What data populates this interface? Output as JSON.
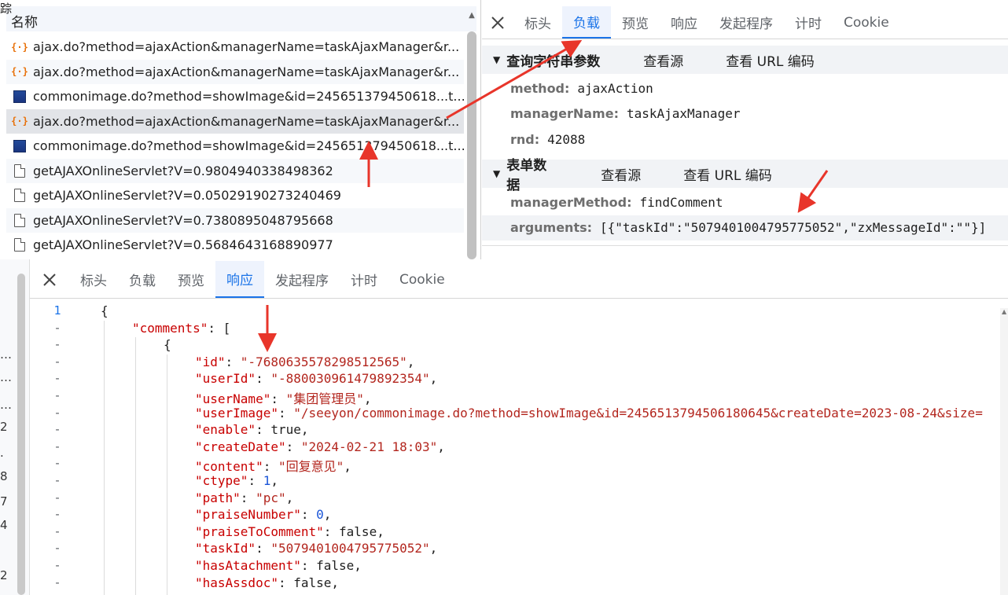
{
  "network": {
    "header": "名称",
    "rows": [
      {
        "icon": "xhr-icon",
        "name": "ajax.do?method=ajaxAction&managerName=taskAjaxManager&r..."
      },
      {
        "icon": "xhr-icon",
        "name": "ajax.do?method=ajaxAction&managerName=taskAjaxManager&r..."
      },
      {
        "icon": "image-icon",
        "name": "commonimage.do?method=showImage&id=245651379450618...t..."
      },
      {
        "icon": "xhr-icon",
        "name": "ajax.do?method=ajaxAction&managerName=taskAjaxManager&r..."
      },
      {
        "icon": "image-icon",
        "name": "commonimage.do?method=showImage&id=245651379450618...t..."
      },
      {
        "icon": "document-icon",
        "name": "getAJAXOnlineServlet?V=0.9804940338498362"
      },
      {
        "icon": "document-icon",
        "name": "getAJAXOnlineServlet?V=0.05029190273240469"
      },
      {
        "icon": "document-icon",
        "name": "getAJAXOnlineServlet?V=0.7380895048795668"
      },
      {
        "icon": "document-icon",
        "name": "getAJAXOnlineServlet?V=0.5684643168890977"
      }
    ],
    "selected_index": 3
  },
  "top_tabs": [
    "标头",
    "负载",
    "预览",
    "响应",
    "发起程序",
    "计时",
    "Cookie"
  ],
  "top_active": "负载",
  "payload": {
    "query": {
      "title": "查询字符串参数",
      "view_source": "查看源",
      "view_url": "查看 URL 编码",
      "params": [
        {
          "key": "method:",
          "value": "ajaxAction"
        },
        {
          "key": "managerName:",
          "value": "taskAjaxManager"
        },
        {
          "key": "rnd:",
          "value": "42088"
        }
      ]
    },
    "form": {
      "title": "表单数据",
      "view_source": "查看源",
      "view_url": "查看 URL 编码",
      "params": [
        {
          "key": "managerMethod:",
          "value": "findComment"
        },
        {
          "key": "arguments:",
          "value": "[{\"taskId\":\"5079401004795775052\",\"zxMessageId\":\"\"}]"
        }
      ]
    }
  },
  "bottom_tabs": [
    "标头",
    "负载",
    "预览",
    "响应",
    "发起程序",
    "计时",
    "Cookie"
  ],
  "bottom_active": "响应",
  "left_strip_labels": [
    "…",
    "…",
    "…",
    "2",
    ".",
    "8",
    "7",
    "4",
    "2"
  ],
  "left_strip_top": "踪",
  "response": {
    "first_line_number": "1",
    "lines": [
      {
        "indent": 0,
        "parts": [
          {
            "t": "{",
            "c": "kw"
          }
        ]
      },
      {
        "indent": 1,
        "parts": [
          {
            "t": "\"comments\"",
            "c": "key"
          },
          {
            "t": ": [",
            "c": "kw"
          }
        ]
      },
      {
        "indent": 2,
        "parts": [
          {
            "t": "{",
            "c": "kw"
          }
        ]
      },
      {
        "indent": 3,
        "parts": [
          {
            "t": "\"id\"",
            "c": "key"
          },
          {
            "t": ": ",
            "c": "kw"
          },
          {
            "t": "\"-7680635578298512565\"",
            "c": "str"
          },
          {
            "t": ",",
            "c": "kw"
          }
        ]
      },
      {
        "indent": 3,
        "parts": [
          {
            "t": "\"userId\"",
            "c": "key"
          },
          {
            "t": ": ",
            "c": "kw"
          },
          {
            "t": "\"-880030961479892354\"",
            "c": "str"
          },
          {
            "t": ",",
            "c": "kw"
          }
        ]
      },
      {
        "indent": 3,
        "parts": [
          {
            "t": "\"userName\"",
            "c": "key"
          },
          {
            "t": ": ",
            "c": "kw"
          },
          {
            "t": "\"集团管理员\"",
            "c": "str"
          },
          {
            "t": ",",
            "c": "kw"
          }
        ]
      },
      {
        "indent": 3,
        "parts": [
          {
            "t": "\"userImage\"",
            "c": "key"
          },
          {
            "t": ": ",
            "c": "kw"
          },
          {
            "t": "\"/seeyon/commonimage.do?method=showImage&id=2456513794506180645&createDate=2023-08-24&size=",
            "c": "str"
          }
        ]
      },
      {
        "indent": 3,
        "parts": [
          {
            "t": "\"enable\"",
            "c": "key"
          },
          {
            "t": ": true,",
            "c": "kw"
          }
        ]
      },
      {
        "indent": 3,
        "parts": [
          {
            "t": "\"createDate\"",
            "c": "key"
          },
          {
            "t": ": ",
            "c": "kw"
          },
          {
            "t": "\"2024-02-21 18:03\"",
            "c": "str"
          },
          {
            "t": ",",
            "c": "kw"
          }
        ]
      },
      {
        "indent": 3,
        "parts": [
          {
            "t": "\"content\"",
            "c": "key"
          },
          {
            "t": ": ",
            "c": "kw"
          },
          {
            "t": "\"回复意见\"",
            "c": "str"
          },
          {
            "t": ",",
            "c": "kw"
          }
        ]
      },
      {
        "indent": 3,
        "parts": [
          {
            "t": "\"ctype\"",
            "c": "key"
          },
          {
            "t": ": ",
            "c": "kw"
          },
          {
            "t": "1",
            "c": "num"
          },
          {
            "t": ",",
            "c": "kw"
          }
        ]
      },
      {
        "indent": 3,
        "parts": [
          {
            "t": "\"path\"",
            "c": "key"
          },
          {
            "t": ": ",
            "c": "kw"
          },
          {
            "t": "\"pc\"",
            "c": "str"
          },
          {
            "t": ",",
            "c": "kw"
          }
        ]
      },
      {
        "indent": 3,
        "parts": [
          {
            "t": "\"praiseNumber\"",
            "c": "key"
          },
          {
            "t": ": ",
            "c": "kw"
          },
          {
            "t": "0",
            "c": "num"
          },
          {
            "t": ",",
            "c": "kw"
          }
        ]
      },
      {
        "indent": 3,
        "parts": [
          {
            "t": "\"praiseToComment\"",
            "c": "key"
          },
          {
            "t": ": false,",
            "c": "kw"
          }
        ]
      },
      {
        "indent": 3,
        "parts": [
          {
            "t": "\"taskId\"",
            "c": "key"
          },
          {
            "t": ": ",
            "c": "kw"
          },
          {
            "t": "\"5079401004795775052\"",
            "c": "str"
          },
          {
            "t": ",",
            "c": "kw"
          }
        ]
      },
      {
        "indent": 3,
        "parts": [
          {
            "t": "\"hasAtachment\"",
            "c": "key"
          },
          {
            "t": ": false,",
            "c": "kw"
          }
        ]
      },
      {
        "indent": 3,
        "parts": [
          {
            "t": "\"hasAssdoc\"",
            "c": "key"
          },
          {
            "t": ": false,",
            "c": "kw"
          }
        ]
      }
    ]
  },
  "colors": {
    "accent": "#1a73e8",
    "arrow": "#e8352a",
    "json_key": "#c80000",
    "json_string": "#b3261e",
    "json_number": "#1a55d8"
  }
}
